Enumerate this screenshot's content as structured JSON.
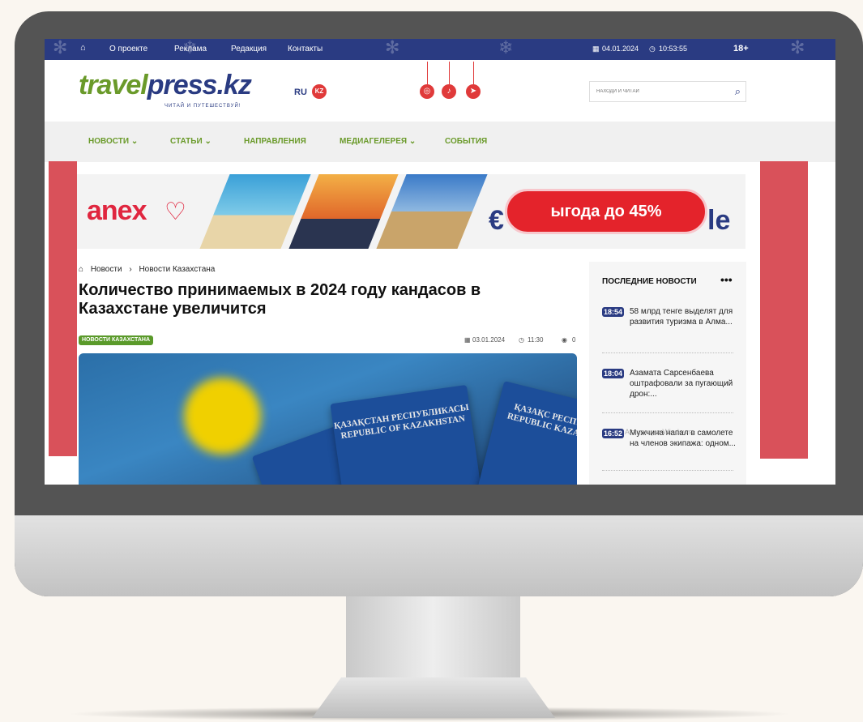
{
  "topbar": {
    "links": [
      "О проекте",
      "Реклама",
      "Редакция",
      "Контакты"
    ],
    "date": "04.01.2024",
    "time": "10:53:55",
    "age_rating": "18+"
  },
  "header": {
    "logo_part1": "travel",
    "logo_part2": "press.kz",
    "tagline": "ЧИТАЙ И ПУТЕШЕСТВУЙ!",
    "lang_ru": "RU",
    "lang_kz": "KZ",
    "search_placeholder": "НАХОДИ И ЧИТАЙ"
  },
  "nav": {
    "items": [
      "НОВОСТИ",
      "СТАТЬИ",
      "НАПРАВЛЕНИЯ",
      "МЕДИАГЕЛЕРЕЯ",
      "СОБЫТИЯ"
    ]
  },
  "banner": {
    "brand": "anex",
    "promo_text": "ыгода до 45%",
    "left_fragment": "€",
    "right_fragment": "le"
  },
  "article": {
    "breadcrumb": [
      "Новости",
      "Новости Казахстана"
    ],
    "title": "Количество принимаемых в 2024 году кандасов в Казахстане увеличится",
    "tag": "НОВОСТИ КАЗАХСТАНА",
    "date": "03.01.2024",
    "time": "11:30",
    "views": "0",
    "passport_text": "ҚАЗАҚСТАН РЕСПУБЛИКАСЫ REPUBLIC OF KAZAKHSTAN",
    "passport_text2": "ҚАЗАҚС РЕСПУБЛИ REPUBLIC KAZAKHST"
  },
  "sidebar": {
    "title": "ПОСЛЕДНИЕ НОВОСТИ",
    "dots": "•••",
    "news": [
      {
        "time": "18:54",
        "text": "58 млрд тенге выделят для развития туризма в Алма..."
      },
      {
        "time": "18:04",
        "text": "Азамата Сарсенбаева оштрафовали за пугающий дрон:..."
      },
      {
        "time": "16:52",
        "text": "Мужчина напал в самолете на членов экипажа: одном..."
      }
    ]
  },
  "watermark": "Активация Windows",
  "colors": {
    "brand_blue": "#2a3b82",
    "brand_green": "#6a9a2a",
    "accent_red": "#e03a3a"
  }
}
